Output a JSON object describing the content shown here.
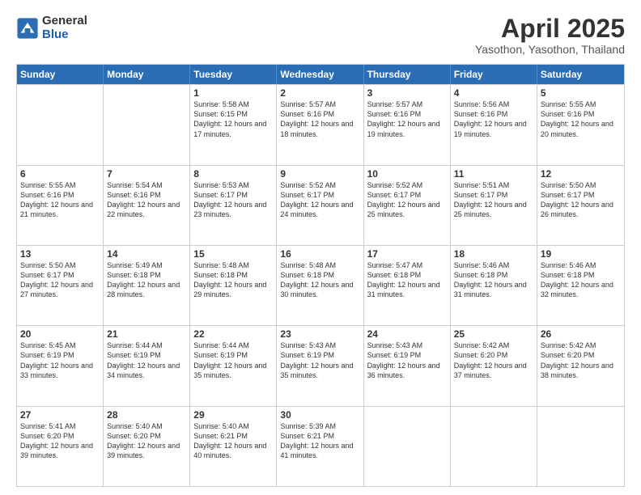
{
  "logo": {
    "general": "General",
    "blue": "Blue"
  },
  "title": "April 2025",
  "subtitle": "Yasothon, Yasothon, Thailand",
  "weekdays": [
    "Sunday",
    "Monday",
    "Tuesday",
    "Wednesday",
    "Thursday",
    "Friday",
    "Saturday"
  ],
  "weeks": [
    [
      {
        "day": "",
        "sunrise": "",
        "sunset": "",
        "daylight": ""
      },
      {
        "day": "",
        "sunrise": "",
        "sunset": "",
        "daylight": ""
      },
      {
        "day": "1",
        "sunrise": "Sunrise: 5:58 AM",
        "sunset": "Sunset: 6:15 PM",
        "daylight": "Daylight: 12 hours and 17 minutes."
      },
      {
        "day": "2",
        "sunrise": "Sunrise: 5:57 AM",
        "sunset": "Sunset: 6:16 PM",
        "daylight": "Daylight: 12 hours and 18 minutes."
      },
      {
        "day": "3",
        "sunrise": "Sunrise: 5:57 AM",
        "sunset": "Sunset: 6:16 PM",
        "daylight": "Daylight: 12 hours and 19 minutes."
      },
      {
        "day": "4",
        "sunrise": "Sunrise: 5:56 AM",
        "sunset": "Sunset: 6:16 PM",
        "daylight": "Daylight: 12 hours and 19 minutes."
      },
      {
        "day": "5",
        "sunrise": "Sunrise: 5:55 AM",
        "sunset": "Sunset: 6:16 PM",
        "daylight": "Daylight: 12 hours and 20 minutes."
      }
    ],
    [
      {
        "day": "6",
        "sunrise": "Sunrise: 5:55 AM",
        "sunset": "Sunset: 6:16 PM",
        "daylight": "Daylight: 12 hours and 21 minutes."
      },
      {
        "day": "7",
        "sunrise": "Sunrise: 5:54 AM",
        "sunset": "Sunset: 6:16 PM",
        "daylight": "Daylight: 12 hours and 22 minutes."
      },
      {
        "day": "8",
        "sunrise": "Sunrise: 5:53 AM",
        "sunset": "Sunset: 6:17 PM",
        "daylight": "Daylight: 12 hours and 23 minutes."
      },
      {
        "day": "9",
        "sunrise": "Sunrise: 5:52 AM",
        "sunset": "Sunset: 6:17 PM",
        "daylight": "Daylight: 12 hours and 24 minutes."
      },
      {
        "day": "10",
        "sunrise": "Sunrise: 5:52 AM",
        "sunset": "Sunset: 6:17 PM",
        "daylight": "Daylight: 12 hours and 25 minutes."
      },
      {
        "day": "11",
        "sunrise": "Sunrise: 5:51 AM",
        "sunset": "Sunset: 6:17 PM",
        "daylight": "Daylight: 12 hours and 25 minutes."
      },
      {
        "day": "12",
        "sunrise": "Sunrise: 5:50 AM",
        "sunset": "Sunset: 6:17 PM",
        "daylight": "Daylight: 12 hours and 26 minutes."
      }
    ],
    [
      {
        "day": "13",
        "sunrise": "Sunrise: 5:50 AM",
        "sunset": "Sunset: 6:17 PM",
        "daylight": "Daylight: 12 hours and 27 minutes."
      },
      {
        "day": "14",
        "sunrise": "Sunrise: 5:49 AM",
        "sunset": "Sunset: 6:18 PM",
        "daylight": "Daylight: 12 hours and 28 minutes."
      },
      {
        "day": "15",
        "sunrise": "Sunrise: 5:48 AM",
        "sunset": "Sunset: 6:18 PM",
        "daylight": "Daylight: 12 hours and 29 minutes."
      },
      {
        "day": "16",
        "sunrise": "Sunrise: 5:48 AM",
        "sunset": "Sunset: 6:18 PM",
        "daylight": "Daylight: 12 hours and 30 minutes."
      },
      {
        "day": "17",
        "sunrise": "Sunrise: 5:47 AM",
        "sunset": "Sunset: 6:18 PM",
        "daylight": "Daylight: 12 hours and 31 minutes."
      },
      {
        "day": "18",
        "sunrise": "Sunrise: 5:46 AM",
        "sunset": "Sunset: 6:18 PM",
        "daylight": "Daylight: 12 hours and 31 minutes."
      },
      {
        "day": "19",
        "sunrise": "Sunrise: 5:46 AM",
        "sunset": "Sunset: 6:18 PM",
        "daylight": "Daylight: 12 hours and 32 minutes."
      }
    ],
    [
      {
        "day": "20",
        "sunrise": "Sunrise: 5:45 AM",
        "sunset": "Sunset: 6:19 PM",
        "daylight": "Daylight: 12 hours and 33 minutes."
      },
      {
        "day": "21",
        "sunrise": "Sunrise: 5:44 AM",
        "sunset": "Sunset: 6:19 PM",
        "daylight": "Daylight: 12 hours and 34 minutes."
      },
      {
        "day": "22",
        "sunrise": "Sunrise: 5:44 AM",
        "sunset": "Sunset: 6:19 PM",
        "daylight": "Daylight: 12 hours and 35 minutes."
      },
      {
        "day": "23",
        "sunrise": "Sunrise: 5:43 AM",
        "sunset": "Sunset: 6:19 PM",
        "daylight": "Daylight: 12 hours and 35 minutes."
      },
      {
        "day": "24",
        "sunrise": "Sunrise: 5:43 AM",
        "sunset": "Sunset: 6:19 PM",
        "daylight": "Daylight: 12 hours and 36 minutes."
      },
      {
        "day": "25",
        "sunrise": "Sunrise: 5:42 AM",
        "sunset": "Sunset: 6:20 PM",
        "daylight": "Daylight: 12 hours and 37 minutes."
      },
      {
        "day": "26",
        "sunrise": "Sunrise: 5:42 AM",
        "sunset": "Sunset: 6:20 PM",
        "daylight": "Daylight: 12 hours and 38 minutes."
      }
    ],
    [
      {
        "day": "27",
        "sunrise": "Sunrise: 5:41 AM",
        "sunset": "Sunset: 6:20 PM",
        "daylight": "Daylight: 12 hours and 39 minutes."
      },
      {
        "day": "28",
        "sunrise": "Sunrise: 5:40 AM",
        "sunset": "Sunset: 6:20 PM",
        "daylight": "Daylight: 12 hours and 39 minutes."
      },
      {
        "day": "29",
        "sunrise": "Sunrise: 5:40 AM",
        "sunset": "Sunset: 6:21 PM",
        "daylight": "Daylight: 12 hours and 40 minutes."
      },
      {
        "day": "30",
        "sunrise": "Sunrise: 5:39 AM",
        "sunset": "Sunset: 6:21 PM",
        "daylight": "Daylight: 12 hours and 41 minutes."
      },
      {
        "day": "",
        "sunrise": "",
        "sunset": "",
        "daylight": ""
      },
      {
        "day": "",
        "sunrise": "",
        "sunset": "",
        "daylight": ""
      },
      {
        "day": "",
        "sunrise": "",
        "sunset": "",
        "daylight": ""
      }
    ]
  ]
}
